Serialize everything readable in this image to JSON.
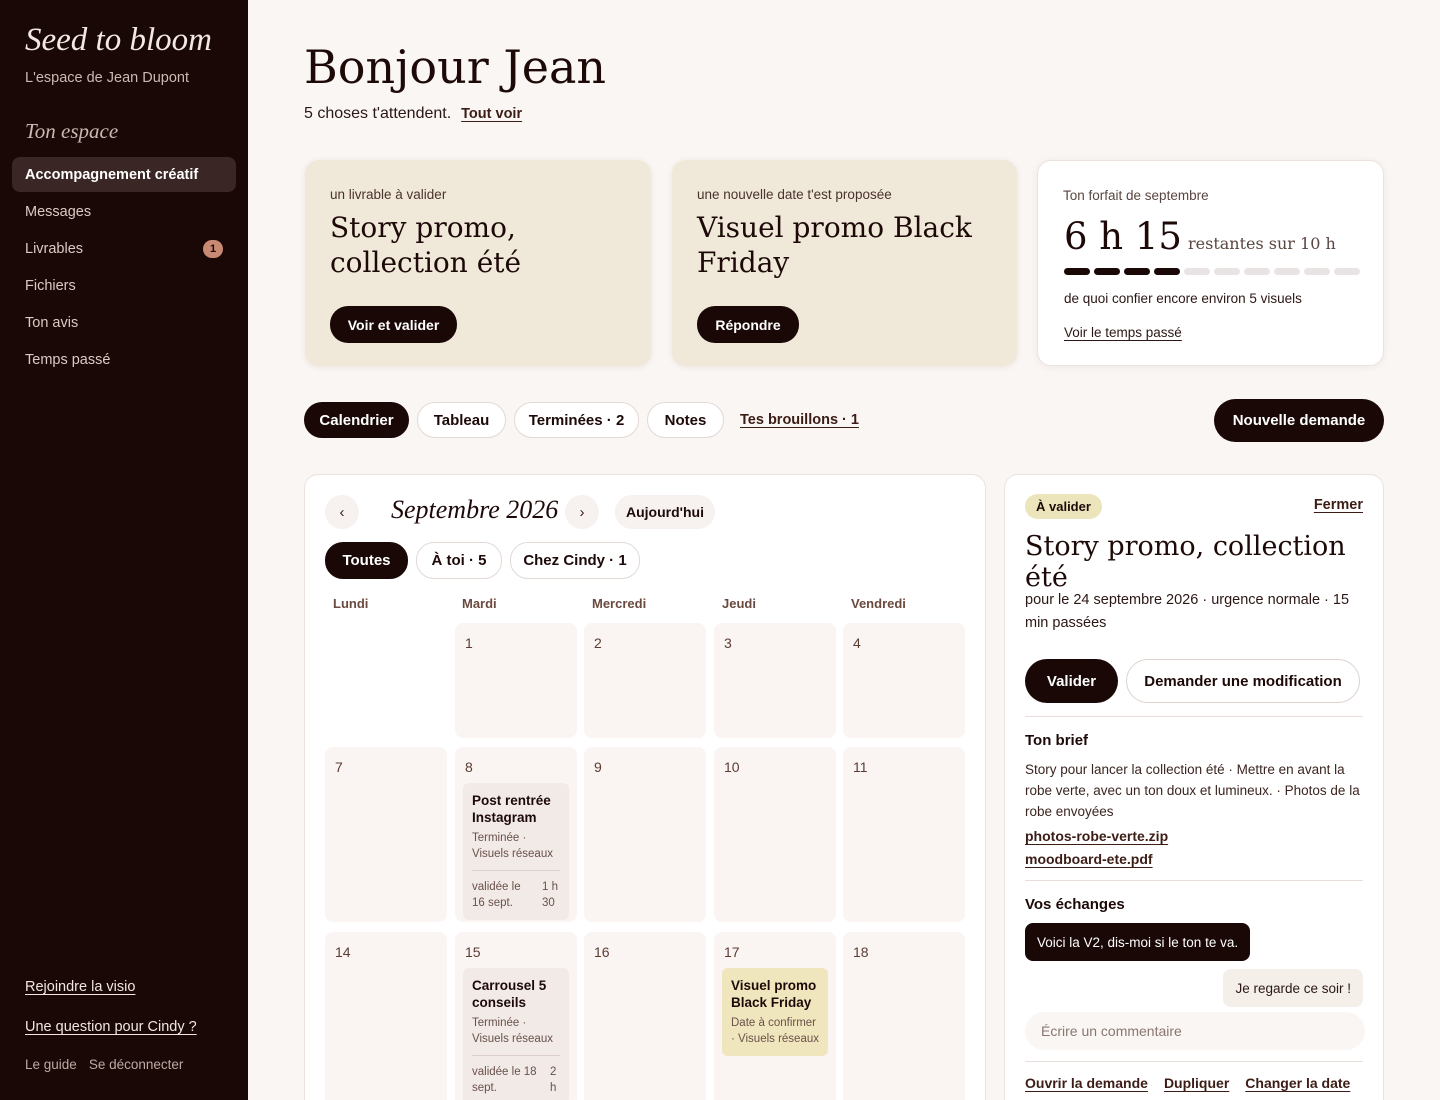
{
  "sidebar": {
    "brand": "Seed to bloom",
    "subtitle": "L'espace de Jean Dupont",
    "section_title": "Ton espace",
    "items": [
      {
        "label": "Accompagnement créatif"
      },
      {
        "label": "Messages"
      },
      {
        "label": "Livrables",
        "badge": "1"
      },
      {
        "label": "Fichiers"
      },
      {
        "label": "Ton avis"
      },
      {
        "label": "Temps passé"
      }
    ],
    "join_visio": "Rejoindre la visio",
    "question": "Une question pour Cindy ?",
    "guide": "Le guide",
    "logout": "Se déconnecter"
  },
  "header": {
    "title": "Bonjour Jean",
    "summary": "5 choses t'attendent.",
    "see_all": "Tout voir"
  },
  "cards": [
    {
      "kicker": "un livrable à valider",
      "title": "Story promo, collection été",
      "button": "Voir et valider"
    },
    {
      "kicker": "une nouvelle date t'est proposée",
      "title": "Visuel promo Black Friday",
      "button": "Répondre"
    }
  ],
  "plan": {
    "kicker": "Ton forfait de septembre",
    "hours": "6 h 15",
    "remaining": "restantes sur 10 h",
    "progress_filled": 4,
    "progress_total": 10,
    "note": "de quoi confier encore environ 5 visuels",
    "link": "Voir le temps passé"
  },
  "views": {
    "tabs": [
      "Calendrier",
      "Tableau",
      "Terminées · 2",
      "Notes"
    ],
    "drafts": "Tes brouillons · 1",
    "new_request": "Nouvelle demande"
  },
  "calendar": {
    "prev": "‹",
    "next": "›",
    "month": "Septembre 2026",
    "today": "Aujourd'hui",
    "filters": [
      "Toutes",
      "À toi · 5",
      "Chez Cindy · 1"
    ],
    "weekdays": [
      "Lundi",
      "Mardi",
      "Mercredi",
      "Jeudi",
      "Vendredi"
    ],
    "days": [
      "1",
      "2",
      "3",
      "4",
      "7",
      "8",
      "9",
      "10",
      "11",
      "14",
      "15",
      "16",
      "17",
      "18"
    ],
    "events": [
      {
        "title": "Post rentrée Instagram",
        "status": "Terminée · Visuels réseaux",
        "validated": "validée le 16 sept.",
        "time": "1 h 30"
      },
      {
        "title": "Carrousel 5 conseils",
        "status": "Terminée · Visuels réseaux",
        "validated": "validée le 18 sept.",
        "time": "2 h"
      },
      {
        "title": "Visuel promo Black Friday",
        "status": "Date à confirmer · Visuels réseaux"
      }
    ]
  },
  "detail": {
    "tag": "À valider",
    "close": "Fermer",
    "title": "Story promo, collection été",
    "meta": "pour le 24 septembre 2026 · urgence normale · 15 min passées",
    "validate": "Valider",
    "request_change": "Demander une modification",
    "brief_title": "Ton brief",
    "brief": "Story pour lancer la collection été · Mettre en avant la robe verte, avec un ton doux et lumineux. · Photos de la robe envoyées",
    "files": [
      "photos-robe-verte.zip",
      "moodboard-ete.pdf"
    ],
    "exchanges_title": "Vos échanges",
    "msg_out": "Voici la V2, dis-moi si le ton te va.",
    "msg_in": "Je regarde ce soir !",
    "comment_placeholder": "Écrire un commentaire",
    "actions": [
      "Ouvrir la demande",
      "Dupliquer",
      "Changer la date"
    ]
  }
}
